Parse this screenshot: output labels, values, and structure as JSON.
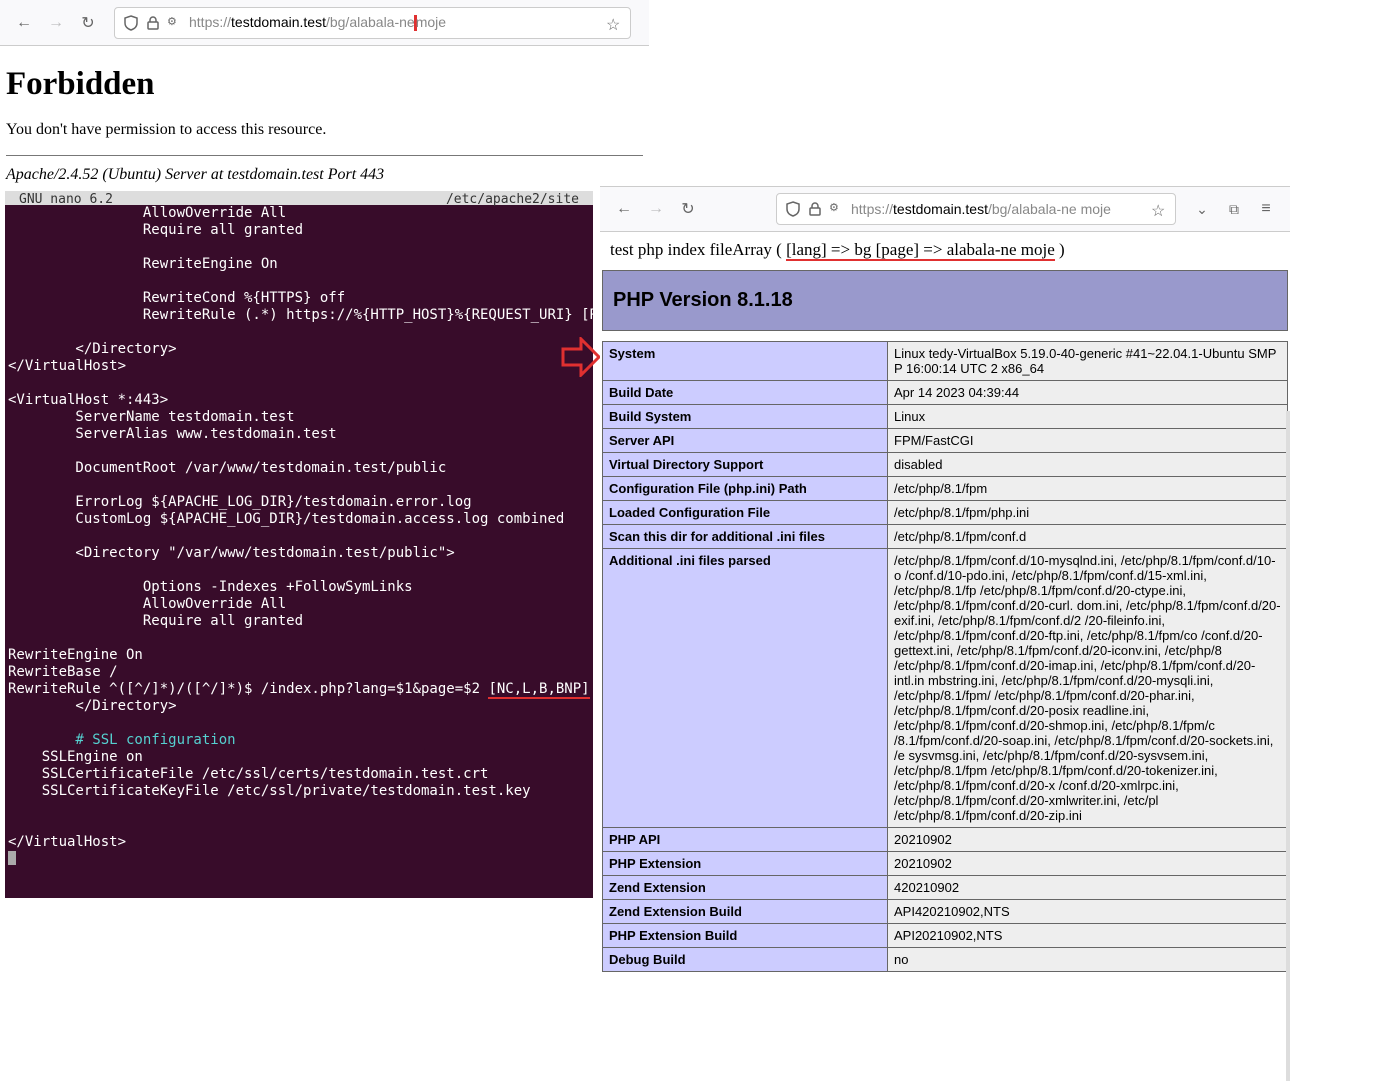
{
  "left_browser": {
    "url_prefix": "https://",
    "url_domain": "testdomain.test",
    "url_path_before_cursor": "/bg/alabala-ne",
    "url_path_after_cursor": "moje",
    "page": {
      "title": "Forbidden",
      "message": "You don't have permission to access this resource.",
      "server_sig": "Apache/2.4.52 (Ubuntu) Server at testdomain.test Port 443"
    }
  },
  "terminal": {
    "editor": "GNU nano 6.2",
    "file": "/etc/apache2/site",
    "config": "                AllowOverride All\n                Require all granted\n\n                RewriteEngine On\n\n                RewriteCond %{HTTPS} off\n                RewriteRule (.*) https://%{HTTP_HOST}%{REQUEST_URI} [R\n\n        </Directory>\n</VirtualHost>\n\n<VirtualHost *:443>\n        ServerName testdomain.test\n        ServerAlias www.testdomain.test\n\n        DocumentRoot /var/www/testdomain.test/public\n\n        ErrorLog ${APACHE_LOG_DIR}/testdomain.error.log\n        CustomLog ${APACHE_LOG_DIR}/testdomain.access.log combined\n\n        <Directory \"/var/www/testdomain.test/public\">\n\n                Options -Indexes +FollowSymLinks\n                AllowOverride All\n                Require all granted\n\nRewriteEngine On\nRewriteBase /",
    "rewrite_rule_prefix": "RewriteRule ^([^/]*)/([^/]*)$ /index.php?lang=$1&page=$2 ",
    "rewrite_rule_flags": "[NC,L,B,BNP]",
    "config2": "        </Directory>\n\n",
    "ssl_comment": "        # SSL configuration",
    "config3": "\n    SSLEngine on\n    SSLCertificateFile /etc/ssl/certs/testdomain.test.crt\n    SSLCertificateKeyFile /etc/ssl/private/testdomain.test.key\n\n\n</VirtualHost>"
  },
  "right_browser": {
    "url_prefix": "https://",
    "url_domain": "testdomain.test",
    "url_path": "/bg/alabala-ne moje",
    "php_line_prefix": "test php index fileArray ( ",
    "php_line_array": "[lang] => bg [page] => alabala-ne moje",
    "php_line_suffix": " )",
    "php_version": "PHP Version 8.1.18",
    "info": [
      {
        "k": "System",
        "v": "Linux tedy-VirtualBox 5.19.0-40-generic #41~22.04.1-Ubuntu SMP P 16:00:14 UTC 2 x86_64"
      },
      {
        "k": "Build Date",
        "v": "Apr 14 2023 04:39:44"
      },
      {
        "k": "Build System",
        "v": "Linux"
      },
      {
        "k": "Server API",
        "v": "FPM/FastCGI"
      },
      {
        "k": "Virtual Directory Support",
        "v": "disabled"
      },
      {
        "k": "Configuration File (php.ini) Path",
        "v": "/etc/php/8.1/fpm"
      },
      {
        "k": "Loaded Configuration File",
        "v": "/etc/php/8.1/fpm/php.ini"
      },
      {
        "k": "Scan this dir for additional .ini files",
        "v": "/etc/php/8.1/fpm/conf.d"
      },
      {
        "k": "Additional .ini files parsed",
        "v": "/etc/php/8.1/fpm/conf.d/10-mysqlnd.ini, /etc/php/8.1/fpm/conf.d/10-o /conf.d/10-pdo.ini, /etc/php/8.1/fpm/conf.d/15-xml.ini, /etc/php/8.1/fp /etc/php/8.1/fpm/conf.d/20-ctype.ini, /etc/php/8.1/fpm/conf.d/20-curl. dom.ini, /etc/php/8.1/fpm/conf.d/20-exif.ini, /etc/php/8.1/fpm/conf.d/2 /20-fileinfo.ini, /etc/php/8.1/fpm/conf.d/20-ftp.ini, /etc/php/8.1/fpm/co /conf.d/20-gettext.ini, /etc/php/8.1/fpm/conf.d/20-iconv.ini, /etc/php/8 /etc/php/8.1/fpm/conf.d/20-imap.ini, /etc/php/8.1/fpm/conf.d/20-intl.in mbstring.ini, /etc/php/8.1/fpm/conf.d/20-mysqli.ini, /etc/php/8.1/fpm/ /etc/php/8.1/fpm/conf.d/20-phar.ini, /etc/php/8.1/fpm/conf.d/20-posix readline.ini, /etc/php/8.1/fpm/conf.d/20-shmop.ini, /etc/php/8.1/fpm/c /8.1/fpm/conf.d/20-soap.ini, /etc/php/8.1/fpm/conf.d/20-sockets.ini, /e sysvmsg.ini, /etc/php/8.1/fpm/conf.d/20-sysvsem.ini, /etc/php/8.1/fpm /etc/php/8.1/fpm/conf.d/20-tokenizer.ini, /etc/php/8.1/fpm/conf.d/20-x /conf.d/20-xmlrpc.ini, /etc/php/8.1/fpm/conf.d/20-xmlwriter.ini, /etc/pl /etc/php/8.1/fpm/conf.d/20-zip.ini"
      },
      {
        "k": "PHP API",
        "v": "20210902"
      },
      {
        "k": "PHP Extension",
        "v": "20210902"
      },
      {
        "k": "Zend Extension",
        "v": "420210902"
      },
      {
        "k": "Zend Extension Build",
        "v": "API420210902,NTS"
      },
      {
        "k": "PHP Extension Build",
        "v": "API20210902,NTS"
      },
      {
        "k": "Debug Build",
        "v": "no"
      }
    ]
  }
}
